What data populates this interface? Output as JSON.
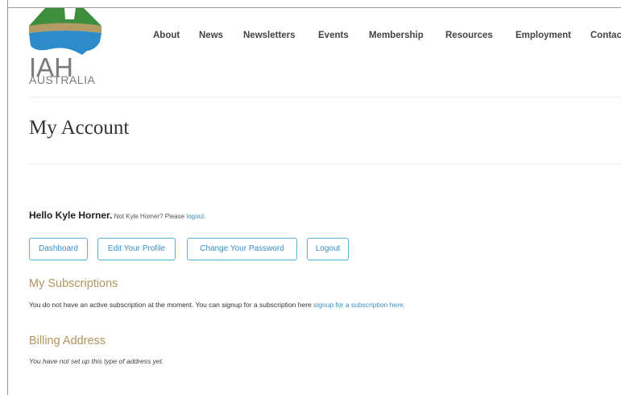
{
  "brand": {
    "logo_main": "IAH",
    "logo_sub": "AUSTRALIA",
    "colors": {
      "green": "#3e8e3e",
      "gold": "#b39b66",
      "blue": "#2d8bc9"
    }
  },
  "nav": {
    "items": [
      {
        "label": "About"
      },
      {
        "label": "News"
      },
      {
        "label": "Newsletters"
      },
      {
        "label": "Events"
      },
      {
        "label": "Membership"
      },
      {
        "label": "Resources"
      },
      {
        "label": "Employment"
      },
      {
        "label": "Contac"
      }
    ]
  },
  "page": {
    "title": "My Account"
  },
  "greeting": {
    "hello": "Hello Kyle Horner.",
    "not_user": " Not Kyle Homer? Please ",
    "logout_link": "logout."
  },
  "actions": {
    "dashboard": "Dashboard",
    "edit_profile": "Edit Your Profile",
    "change_password": "Change Your Password",
    "logout": "Logout"
  },
  "subscriptions": {
    "heading": "My Subscriptions",
    "text": "You do not have an active subscription at the moment. You can signup for a subscription here ",
    "link": "signup for a subscription here."
  },
  "billing": {
    "heading": "Billing Address",
    "text": "You have not set up this type of address yet."
  },
  "theme": {
    "accent_link": "#3a8fc7",
    "heading_gold": "#b0955e",
    "button_border": "#5ab1d9"
  }
}
